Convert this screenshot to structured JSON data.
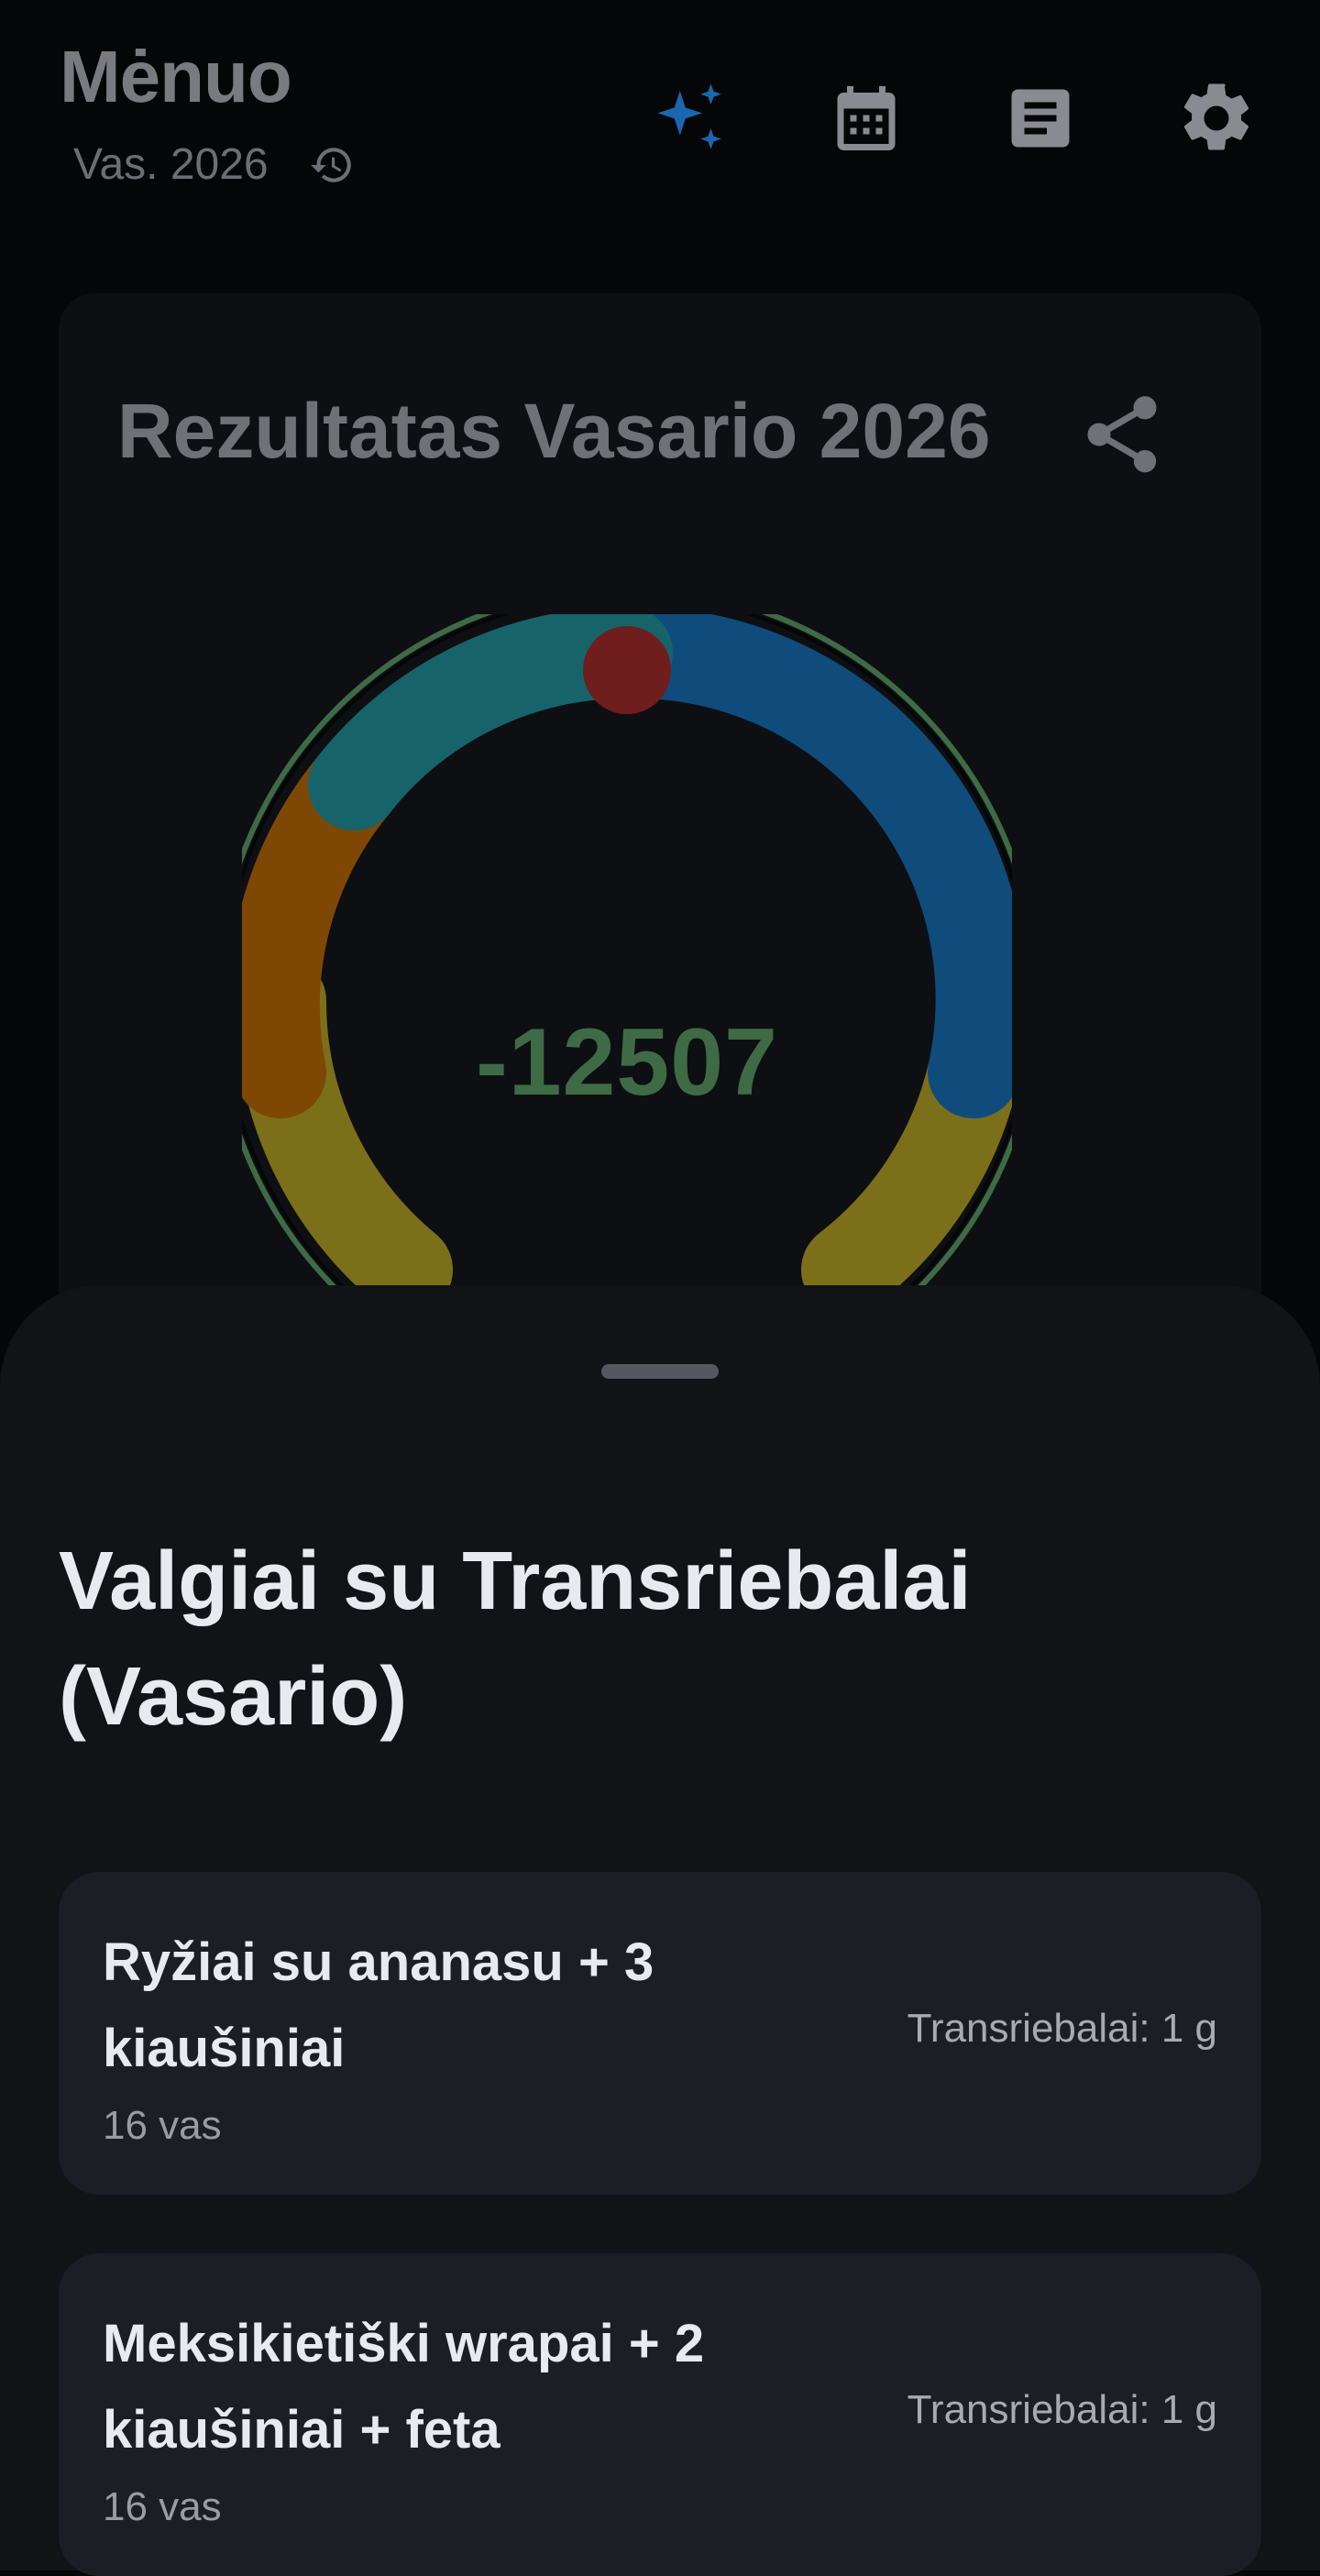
{
  "header": {
    "title": "Mėnuo",
    "month": "Vas. 2026",
    "icons": [
      "history-icon",
      "sparkle-icon",
      "calendar-icon",
      "document-icon",
      "settings-icon"
    ]
  },
  "result": {
    "title": "Rezultatas Vasario 2026",
    "value": "-12507",
    "colors": {
      "ring_border": "#3e6b45",
      "teal": "#17636a",
      "blue": "#0f4c7c",
      "orange": "#7e4804",
      "olive": "#7c6f1a",
      "red": "#701d1d"
    }
  },
  "sheet": {
    "title": "Valgiai su Transriebalai (Vasario)",
    "meals": [
      {
        "name": "Ryžiai su ananasu + 3 kiaušiniai",
        "date": "16 vas",
        "trans": "Transriebalai: 1 g"
      },
      {
        "name": "Meksikietiški wrapai + 2 kiaušiniai + feta",
        "date": "16 vas",
        "trans": "Transriebalai: 1 g"
      }
    ]
  }
}
